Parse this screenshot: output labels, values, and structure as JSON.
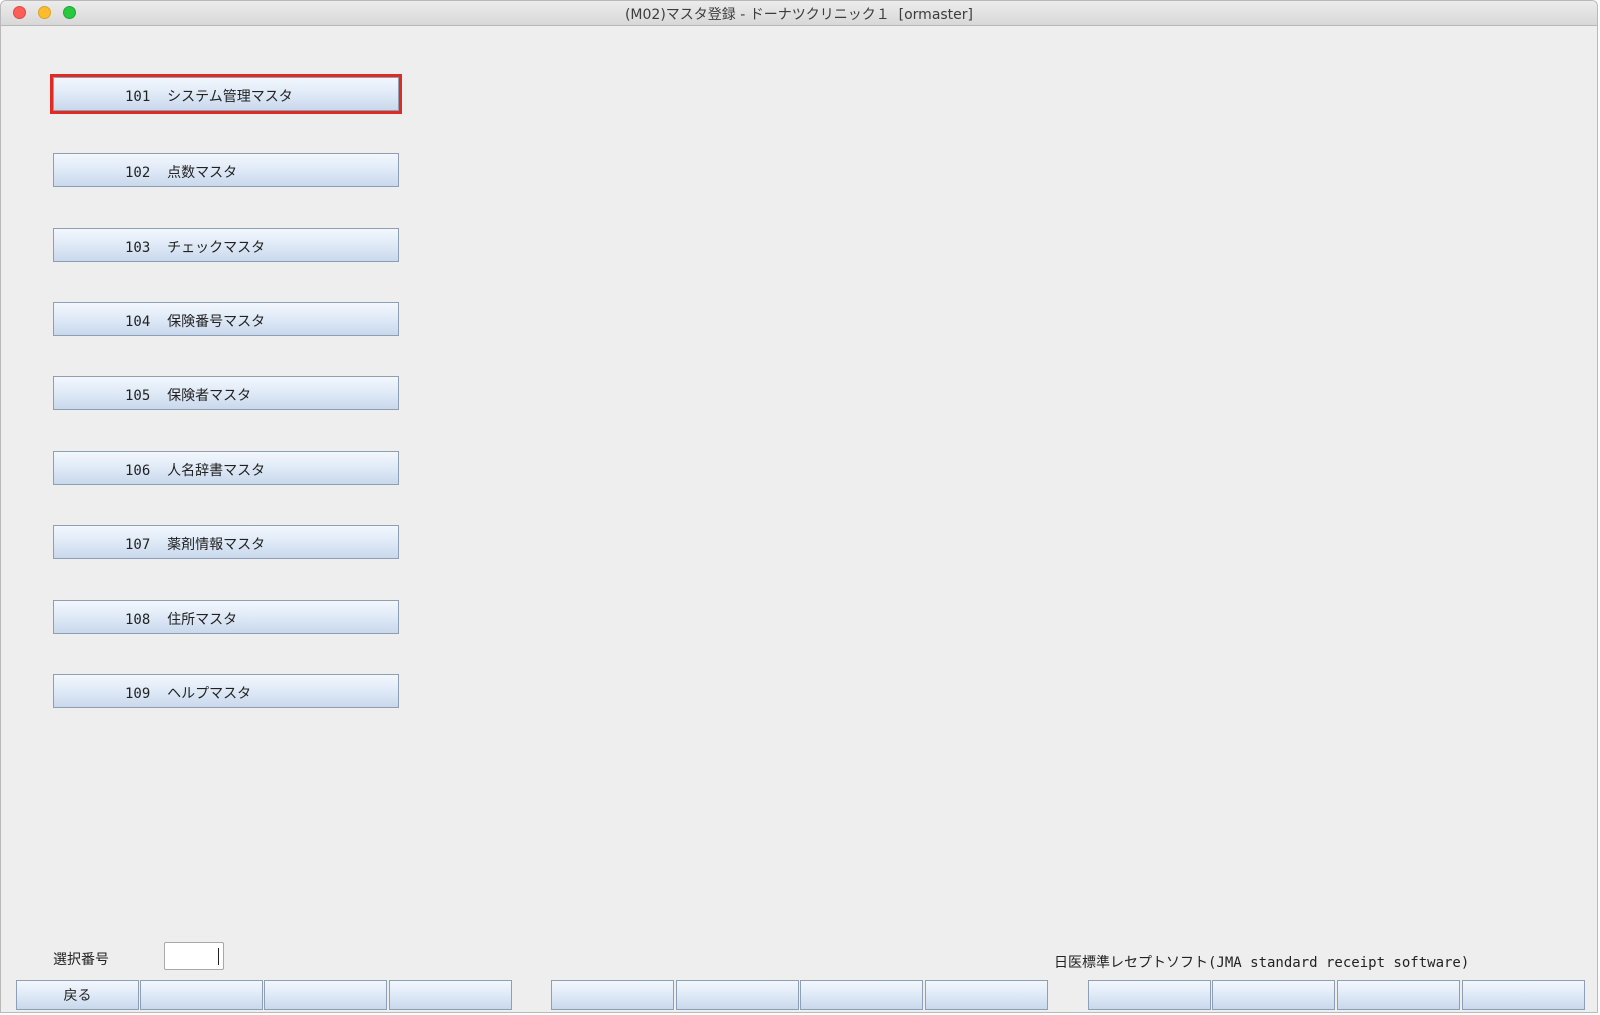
{
  "window": {
    "title": "(M02)マスタ登録 - ドーナツクリニック１  [ormaster]"
  },
  "menu": {
    "items": [
      {
        "label": "101  システム管理マスタ",
        "focused": true
      },
      {
        "label": "102  点数マスタ"
      },
      {
        "label": "103  チェックマスタ"
      },
      {
        "label": "104  保険番号マスタ"
      },
      {
        "label": "105  保険者マスタ"
      },
      {
        "label": "106  人名辞書マスタ"
      },
      {
        "label": "107  薬剤情報マスタ"
      },
      {
        "label": "108  住所マスタ"
      },
      {
        "label": "109  ヘルプマスタ"
      }
    ]
  },
  "selection": {
    "label": "選択番号",
    "value": ""
  },
  "footer": {
    "text": "日医標準レセプトソフト(JMA standard receipt software)"
  },
  "function_keys": [
    {
      "label": "戻る"
    },
    {
      "label": ""
    },
    {
      "label": ""
    },
    {
      "label": ""
    },
    {
      "label": ""
    },
    {
      "label": ""
    },
    {
      "label": ""
    },
    {
      "label": ""
    },
    {
      "label": ""
    },
    {
      "label": ""
    },
    {
      "label": ""
    },
    {
      "label": ""
    }
  ],
  "colors": {
    "focus_outline": "#e02a24",
    "button_gradient_top": "#f3f7fd",
    "button_gradient_bottom": "#c9d8ec",
    "window_background": "#eeeeee"
  }
}
